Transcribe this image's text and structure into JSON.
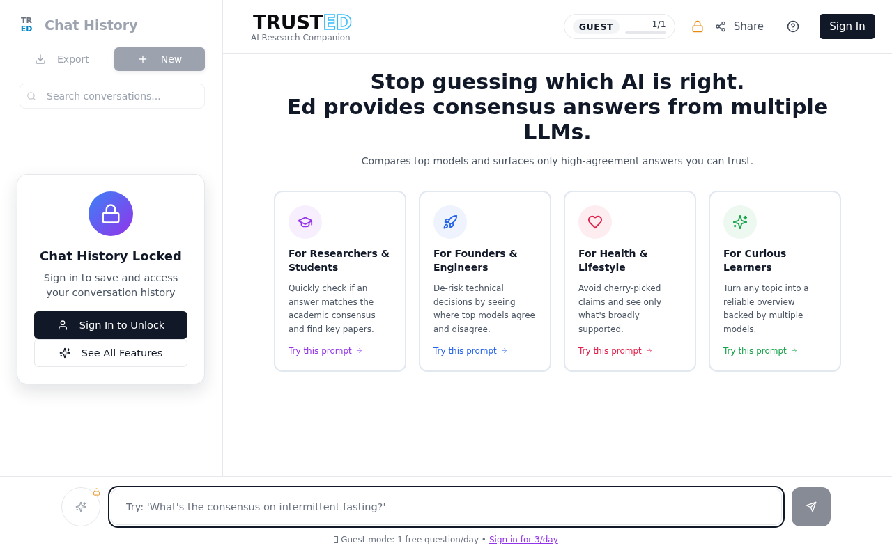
{
  "sidebar": {
    "logo": {
      "top": "TR",
      "bottom": "ED"
    },
    "title": "Chat History",
    "export_button": "Export",
    "new_button": "New",
    "search": {
      "placeholder": "Search conversations..."
    },
    "locked_card": {
      "title": "Chat History Locked",
      "text": "Sign in to save and access your conversation history",
      "buttons": [
        {
          "label": "Sign In to Unlock",
          "kind": "primary"
        },
        {
          "label": "See All Features",
          "kind": "secondary"
        }
      ]
    }
  },
  "header": {
    "logo": {
      "main": "TRUST",
      "accent": "ED",
      "tagline": "AI Research Companion"
    },
    "guest": {
      "badge": "GUEST",
      "count": "1/1",
      "level": 1
    },
    "share": "Share",
    "sign_in": "Sign In"
  },
  "hero": {
    "title": [
      "Stop guessing which AI is right.",
      "Ed provides consensus answers from multiple LLMs."
    ],
    "subtitle": "Compares top models and surfaces only high-agreement answers you can trust."
  },
  "cards": [
    {
      "title": "For Researchers & Students",
      "text": "Quickly check if an answer matches the academic consensus and find key papers.",
      "link": "Try this prompt",
      "color": "#9333ea"
    },
    {
      "title": "For Founders & Engineers",
      "text": "De-risk technical decisions by seeing where top models agree and disagree.",
      "link": "Try this prompt",
      "color": "#2563eb"
    },
    {
      "title": "For Health & Lifestyle",
      "text": "Avoid cherry-picked claims and see only what's broadly supported.",
      "link": "Try this prompt",
      "color": "#e11d48"
    },
    {
      "title": "For Curious Learners",
      "text": "Turn any topic into a reliable overview backed by multiple models.",
      "link": "Try this prompt",
      "color": "#16a34a"
    }
  ],
  "composer": {
    "placeholder": "Try: 'What's the consensus on intermittent fasting?'",
    "note": "Guest mode: 1 free question/day •",
    "link": "Sign in for 3/day"
  }
}
